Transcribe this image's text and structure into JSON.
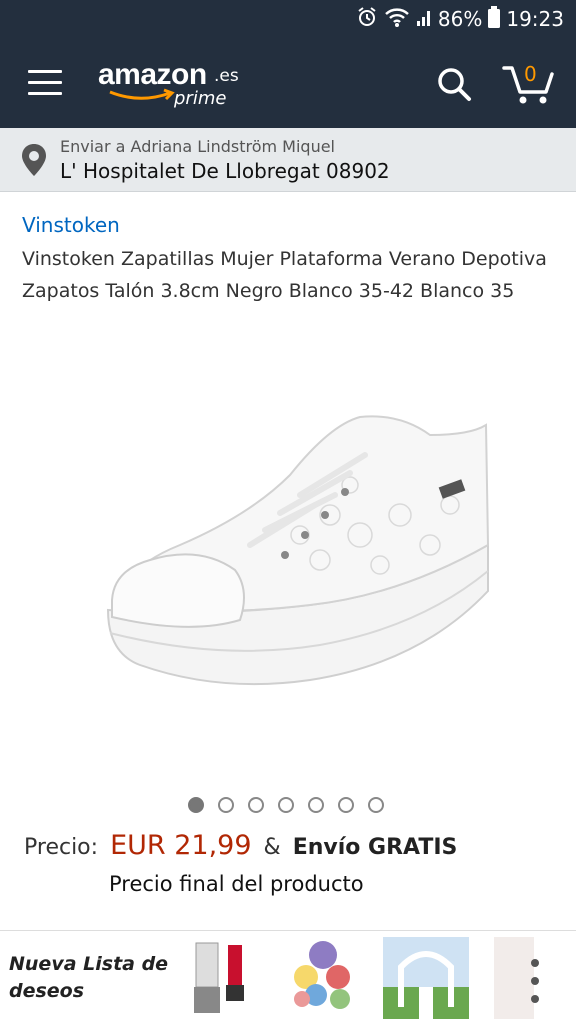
{
  "status_bar": {
    "battery": "86%",
    "time": "19:23"
  },
  "header": {
    "logo_word": "amazon",
    "logo_tld": ".es",
    "logo_sub": "prime",
    "cart_count": "0"
  },
  "delivery": {
    "line1": "Enviar a Adriana Lindström Miquel",
    "line2": "L' Hospitalet De Llobregat 08902"
  },
  "product": {
    "brand": "Vinstoken",
    "title": "Vinstoken Zapatillas Mujer Plataforma Verano Depotiva Zapatos Talón 3.8cm Negro Blanco 35-42 Blanco 35",
    "image_count": 7,
    "active_image": 1
  },
  "price": {
    "label": "Precio:",
    "amount": "EUR 21,99",
    "amp": "&",
    "shipping": "Envío GRATIS",
    "final_note": "Precio final del producto"
  },
  "bottom_bar": {
    "wishlist_label": "Nueva Lista de deseos"
  },
  "colors": {
    "header_bg": "#232f3e",
    "accent": "#ff9900",
    "link": "#0066c0",
    "price": "#b12704"
  }
}
